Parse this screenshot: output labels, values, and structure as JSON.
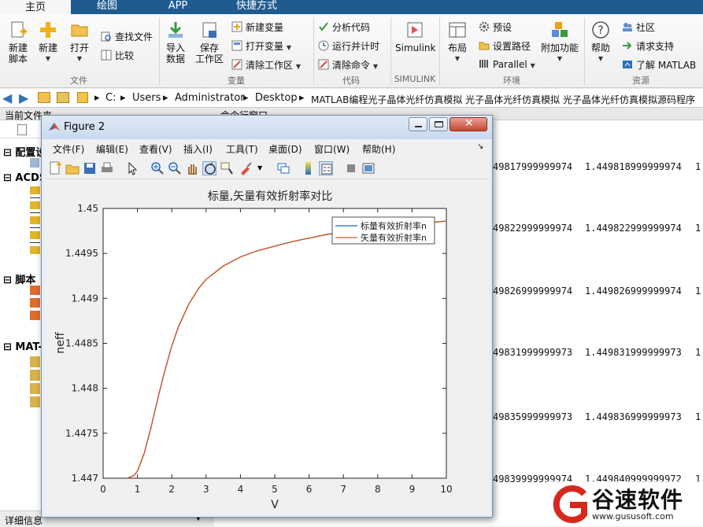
{
  "tabs": [
    {
      "label": "主页",
      "active": true
    },
    {
      "label": "绘图",
      "active": false
    },
    {
      "label": "APP",
      "active": false
    },
    {
      "label": "快捷方式",
      "active": false
    }
  ],
  "ribbon": {
    "new_script": "新建\n脚本",
    "new": "新建",
    "open": "打开",
    "find_files": "查找文件",
    "compare": "比较",
    "import_data": "导入\n数据",
    "save_workspace": "保存\n工作区",
    "new_variable": "新建变量",
    "open_variable": "打开变量",
    "clear_workspace": "清除工作区",
    "analyze_code": "分析代码",
    "run_and_time": "运行并计时",
    "clear_commands": "清除命令",
    "simulink": "Simulink",
    "layout": "布局",
    "preferences": "预设",
    "set_path": "设置路径",
    "parallel": "Parallel",
    "addons": "附加功能",
    "help": "帮助",
    "community": "社区",
    "request_support": "请求支持",
    "learn_matlab": "了解 MATLAB",
    "groups": {
      "file": "文件",
      "variable": "变量",
      "code": "代码",
      "simulink": "SIMULINK",
      "environment": "环境",
      "resources": "资源"
    }
  },
  "path": [
    "C:",
    "Users",
    "Administrator",
    "Desktop",
    "MATLAB编程光子晶体光纤仿真模拟 光子晶体光纤仿真模拟 光子晶体光纤仿真模拟源码程序"
  ],
  "left_panel": {
    "title": "当前文件夹",
    "sections": [
      "配置设",
      "ACDS",
      "脚本",
      "MAT-"
    ],
    "details": "详细信息"
  },
  "command_window": {
    "title": "命令行窗口",
    "col1": [
      "49817999999974",
      "49822999999974",
      "49826999999974",
      "49831999999973",
      "49835999999973",
      "49839999999974"
    ],
    "col2": [
      "1.449818999999974",
      "1.449822999999974",
      "1.449826999999974",
      "1.449831999999973",
      "1.449836999999973",
      "1.449840999999972"
    ],
    "col3": [
      "1.",
      "1.",
      "1.",
      "1.",
      "1.",
      "1."
    ]
  },
  "figure": {
    "title": "Figure 2",
    "menu": [
      "文件(F)",
      "编辑(E)",
      "查看(V)",
      "插入(I)",
      "工具(T)",
      "桌面(D)",
      "窗口(W)",
      "帮助(H)"
    ]
  },
  "chart_data": {
    "type": "line",
    "title": "标量,矢量有效折射率对比",
    "xlabel": "V",
    "ylabel": "neff",
    "xlim": [
      0,
      10
    ],
    "ylim": [
      1.447,
      1.45
    ],
    "xticks": [
      "0",
      "1",
      "2",
      "3",
      "4",
      "5",
      "6",
      "7",
      "8",
      "9",
      "10"
    ],
    "yticks": [
      "1.447",
      "1.4475",
      "1.448",
      "1.4485",
      "1.449",
      "1.4495",
      "1.45"
    ],
    "legend_position": "top-right",
    "grid": false,
    "series": [
      {
        "name": "标量有效折射率n",
        "color": "#0072bd",
        "x": [
          0.7,
          0.9,
          1.0,
          1.2,
          1.4,
          1.6,
          1.8,
          2.0,
          2.2,
          2.5,
          2.8,
          3.0,
          3.5,
          4.0,
          4.5,
          5.0,
          5.5,
          6.0,
          6.5,
          7.0,
          7.5,
          8.0,
          8.5,
          9.0,
          9.5,
          10.0
        ],
        "y": [
          1.447,
          1.44703,
          1.44708,
          1.44728,
          1.44757,
          1.4479,
          1.4482,
          1.44847,
          1.44869,
          1.44894,
          1.44912,
          1.44921,
          1.44936,
          1.44946,
          1.44953,
          1.44958,
          1.44963,
          1.44967,
          1.44971,
          1.44974,
          1.44977,
          1.44979,
          1.44981,
          1.44983,
          1.44984,
          1.44986
        ]
      },
      {
        "name": "矢量有效折射率n",
        "color": "#d95319",
        "x": [
          0.7,
          0.9,
          1.0,
          1.2,
          1.4,
          1.6,
          1.8,
          2.0,
          2.2,
          2.5,
          2.8,
          3.0,
          3.5,
          4.0,
          4.5,
          5.0,
          5.5,
          6.0,
          6.5,
          7.0,
          7.5,
          8.0,
          8.5,
          9.0,
          9.5,
          10.0
        ],
        "y": [
          1.447,
          1.44703,
          1.44708,
          1.44728,
          1.44757,
          1.4479,
          1.4482,
          1.44847,
          1.44869,
          1.44894,
          1.44912,
          1.44921,
          1.44936,
          1.44946,
          1.44953,
          1.44958,
          1.44963,
          1.44967,
          1.44971,
          1.44974,
          1.44977,
          1.44979,
          1.44981,
          1.44983,
          1.44984,
          1.44986
        ]
      }
    ]
  },
  "status": {
    "details": "详细信息"
  },
  "watermark": {
    "brand": "谷速软件",
    "url": "www.gususoft.com"
  },
  "colors": {
    "tabbar": "#1f5b8e",
    "accent": "#d6281c"
  }
}
